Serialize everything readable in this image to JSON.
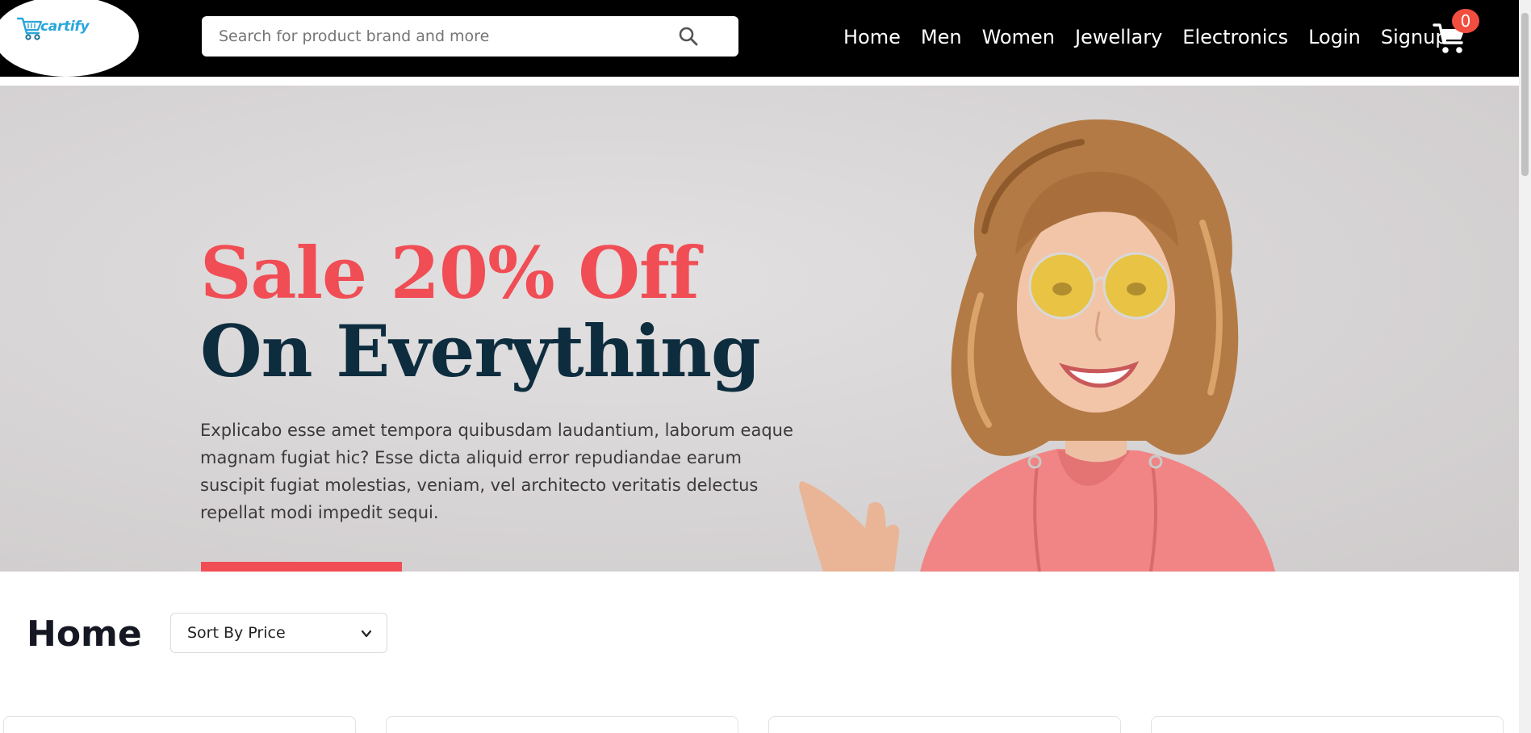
{
  "brand": {
    "name": "cartify",
    "color": "#2aa6db"
  },
  "search": {
    "placeholder": "Search for product brand and more",
    "value": "",
    "icon": "search-icon"
  },
  "nav": {
    "items": [
      {
        "label": "Home"
      },
      {
        "label": "Men"
      },
      {
        "label": "Women"
      },
      {
        "label": "Jewellary"
      },
      {
        "label": "Electronics"
      },
      {
        "label": "Login"
      },
      {
        "label": "Signup"
      }
    ]
  },
  "cart": {
    "icon": "cart-icon",
    "count": "0",
    "badge_color": "#f24e40"
  },
  "hero": {
    "title_line1": "Sale 20% Off",
    "title_line2": "On Everything",
    "description": "Explicabo esse amet tempora quibusdam laudantium, laborum eaque magnam fugiat hic? Esse dicta aliquid error repudiandae earum suscipit fugiat molestias, veniam, vel architecto veritatis delectus repellat modi impedit sequi.",
    "accent_color": "#f04d55",
    "dark_color": "#0d2d3f"
  },
  "main": {
    "title": "Home",
    "sort": {
      "selected": "Sort By Price",
      "icon": "chevron-down-icon"
    }
  }
}
